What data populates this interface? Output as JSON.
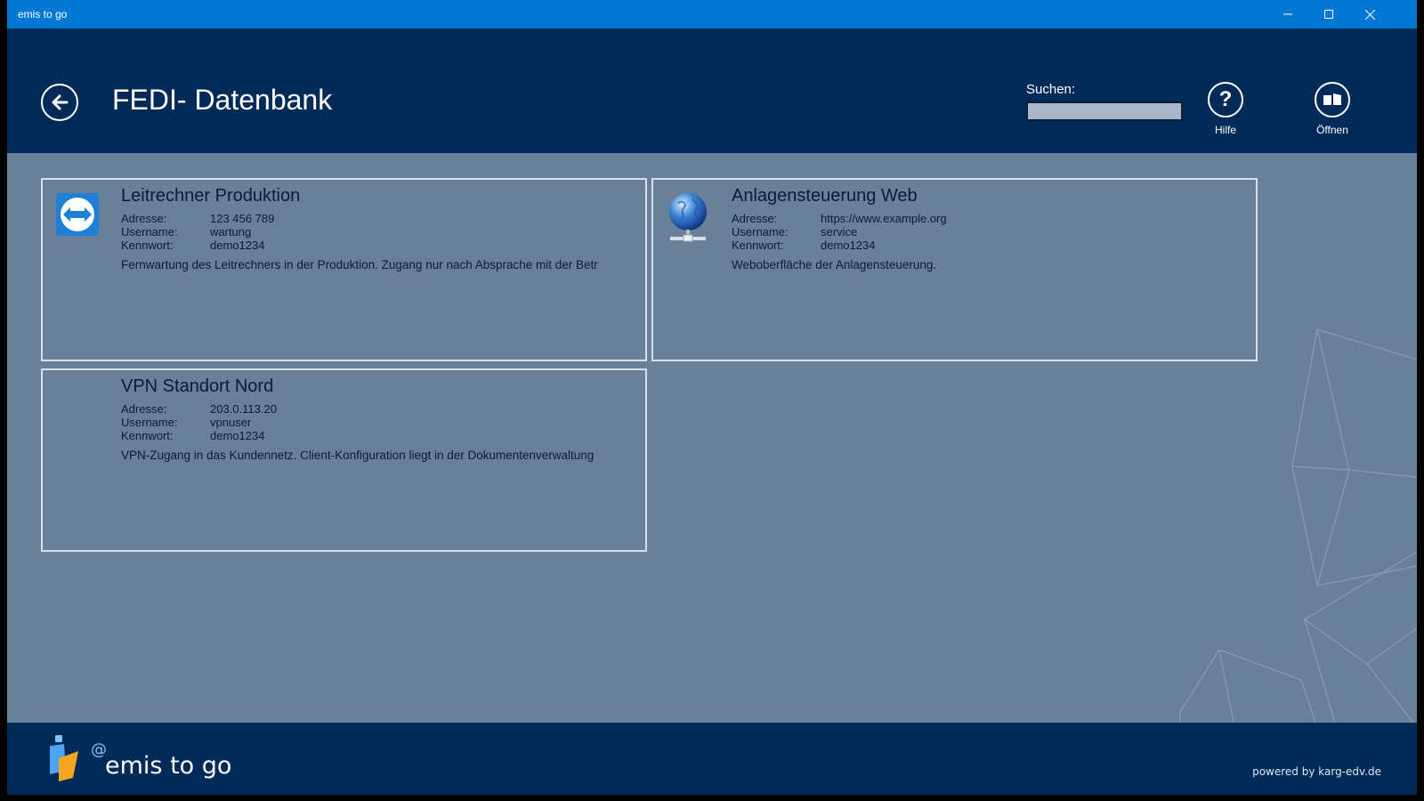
{
  "window": {
    "title": "emis to go"
  },
  "header": {
    "page_title": "FEDI- Datenbank",
    "search": {
      "label": "Suchen:",
      "value": "",
      "placeholder": ""
    },
    "help_label": "Hilfe",
    "open_label": "Öffnen"
  },
  "entries": [
    {
      "title": "Leitrechner Produktion",
      "icon": "teamviewer-icon",
      "address_label": "Adresse:",
      "address": "123 456 789",
      "user_label": "Username:",
      "user": "wartung",
      "pass_label": "Kennwort:",
      "pass": "demo1234",
      "description": "Fernwartung des Leitrechners in der Produktion. Zugang nur nach Absprache mit der Betr"
    },
    {
      "title": "Anlagensteuerung Web",
      "icon": "globe-network-icon",
      "address_label": "Adresse:",
      "address": "https://www.example.org",
      "user_label": "Username:",
      "user": "service",
      "pass_label": "Kennwort:",
      "pass": "demo1234",
      "description": "Weboberfläche der Anlagensteuerung."
    },
    {
      "title": "VPN Standort Nord",
      "icon": "",
      "address_label": "Adresse:",
      "address": "203.0.113.20",
      "user_label": "Username:",
      "user": "vpnuser",
      "pass_label": "Kennwort:",
      "pass": "demo1234",
      "description": "VPN-Zugang in das Kundennetz. Client-Konfiguration liegt in der Dokumentenverwaltung"
    }
  ],
  "footer": {
    "brand": "emis to go",
    "powered_by": "powered by karg-edv.de"
  },
  "colors": {
    "titlebar": "#0078d4",
    "header": "#002a58",
    "content": "#6a7f98",
    "card_border": "#d6e0ec"
  }
}
